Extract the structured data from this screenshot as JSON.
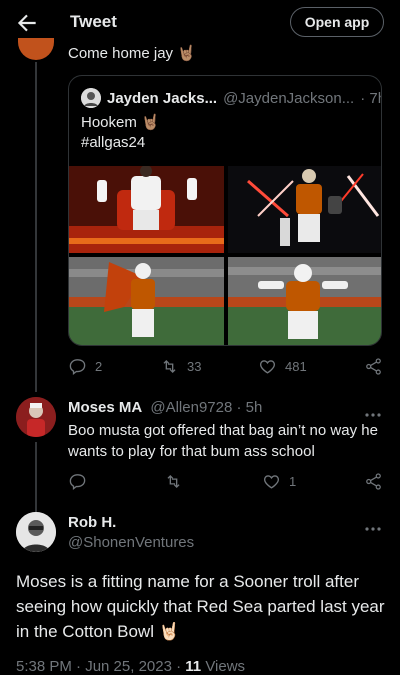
{
  "header": {
    "title": "Tweet",
    "open_app": "Open app"
  },
  "parent_snippet": "Come home jay 🤘🏽",
  "quote": {
    "name": "Jayden Jacks...",
    "handle": "@JaydenJackson...",
    "time": "· 7h",
    "line1": "Hookem 🤘🏽",
    "line2": "#allgas24"
  },
  "quote_actions": {
    "replies": "2",
    "retweets": "33",
    "likes": "481"
  },
  "reply": {
    "name": "Moses MA",
    "handle": "@Allen9728 · 5h",
    "text": "Boo musta got offered that bag ain’t no way he wants to play for that bum ass school"
  },
  "reply_actions": {
    "likes": "1"
  },
  "main": {
    "name": "Rob H.",
    "handle": "@ShonenVentures",
    "text": "Moses is a fitting name for a Sooner troll after seeing how quickly that Red Sea parted last year in the Cotton Bowl 🤘🏻",
    "time": "5:38 PM · Jun 25, 2023 ·",
    "views_count": "11",
    "views_label": "Views"
  },
  "colors": {
    "accent": "#1d9bf0",
    "muted": "#71767b",
    "burnt_orange": "#bf5700"
  }
}
